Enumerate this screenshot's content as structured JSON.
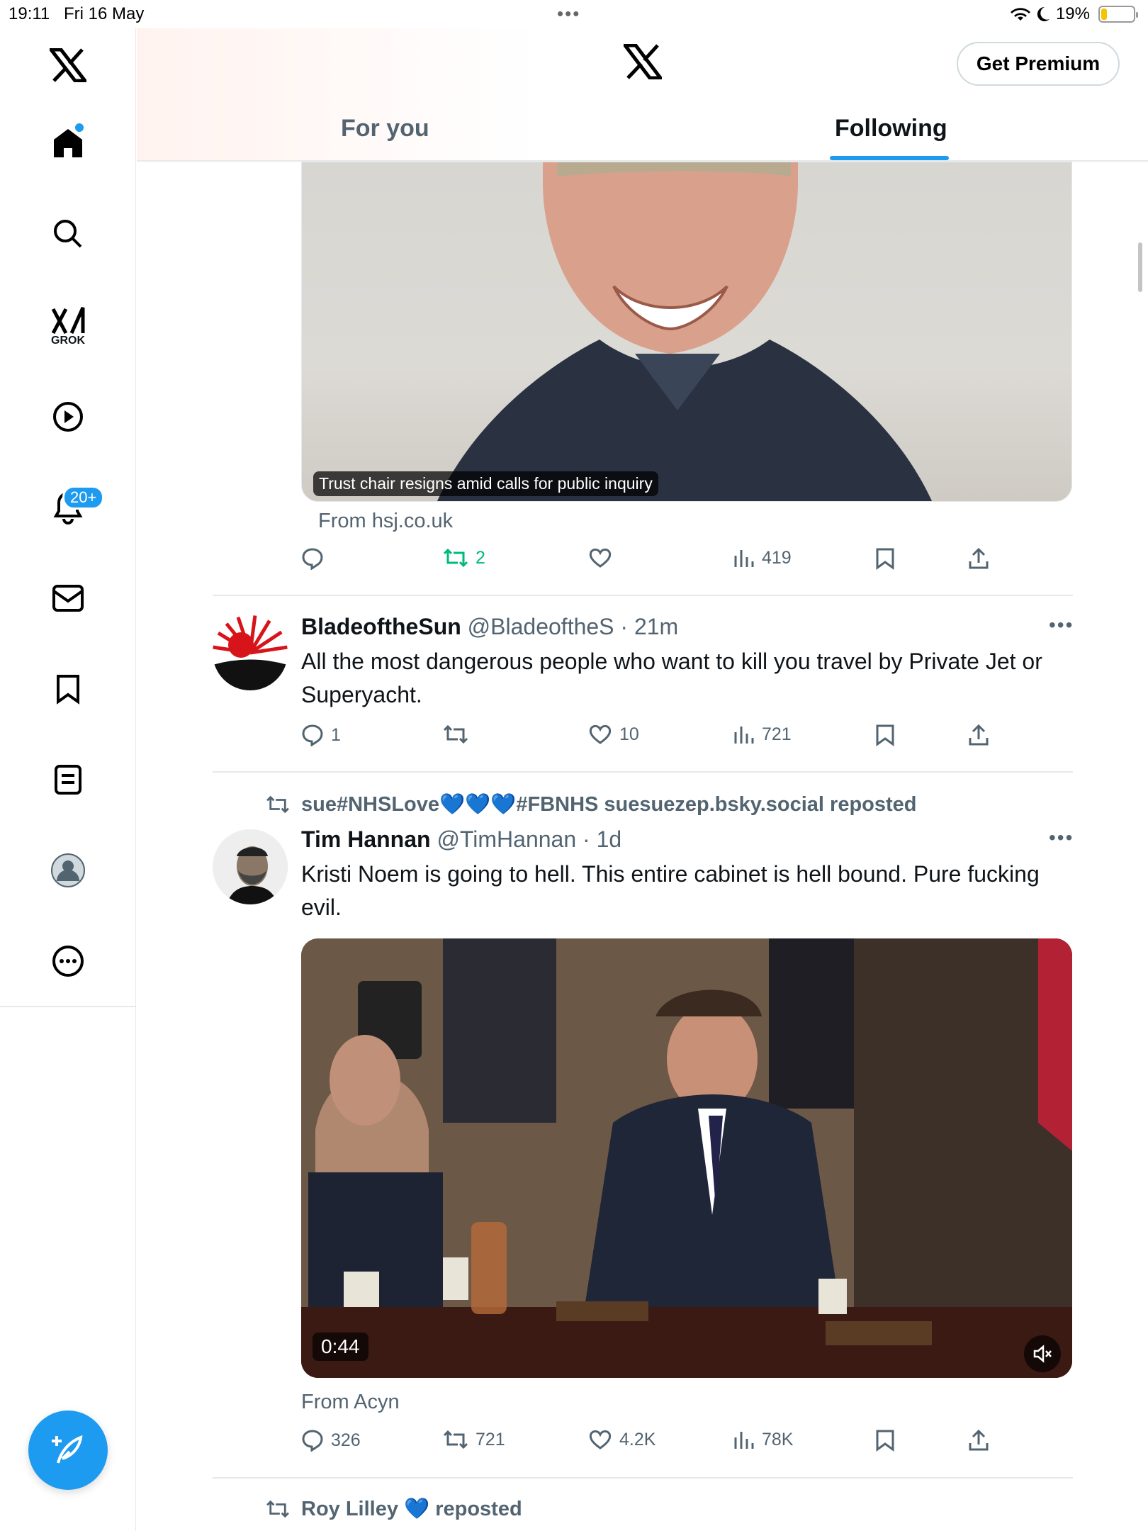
{
  "status": {
    "time": "19:11",
    "date": "Fri 16 May",
    "battery": "19%",
    "battery_level": 0.19
  },
  "sidebar": {
    "grok_label": "GROK",
    "notifications_badge": "20+"
  },
  "header": {
    "premium_button": "Get Premium",
    "tabs": [
      {
        "label": "For you",
        "active": false
      },
      {
        "label": "Following",
        "active": true
      }
    ]
  },
  "tweet1": {
    "image_caption": "Trust chair resigns amid calls for public inquiry",
    "from": "From hsj.co.uk",
    "reposts": "2",
    "views": "419"
  },
  "tweet2": {
    "name": "BladeoftheSun",
    "handle": "@BladeoftheS · 21m",
    "text": "All the most dangerous people who want to kill you travel by Private Jet or Superyacht.",
    "replies": "1",
    "likes": "10",
    "views": "721"
  },
  "tweet3": {
    "reposted_by": "sue#NHSLove💙💙💙#FBNHS suesuezep.bsky.social reposted",
    "name": "Tim Hannan",
    "handle": "@TimHannan · 1d",
    "text": "Kristi Noem is going to hell. This entire cabinet is hell bound. Pure fucking evil.",
    "video_duration": "0:44",
    "from": "From Acyn",
    "replies": "326",
    "reposts": "721",
    "likes": "4.2K",
    "views": "78K"
  },
  "tweet4": {
    "reposted_by": "Roy Lilley 💙 reposted"
  },
  "colors": {
    "accent": "#1d9bf0",
    "repost_active": "#00ba7c",
    "muted": "#536471"
  }
}
